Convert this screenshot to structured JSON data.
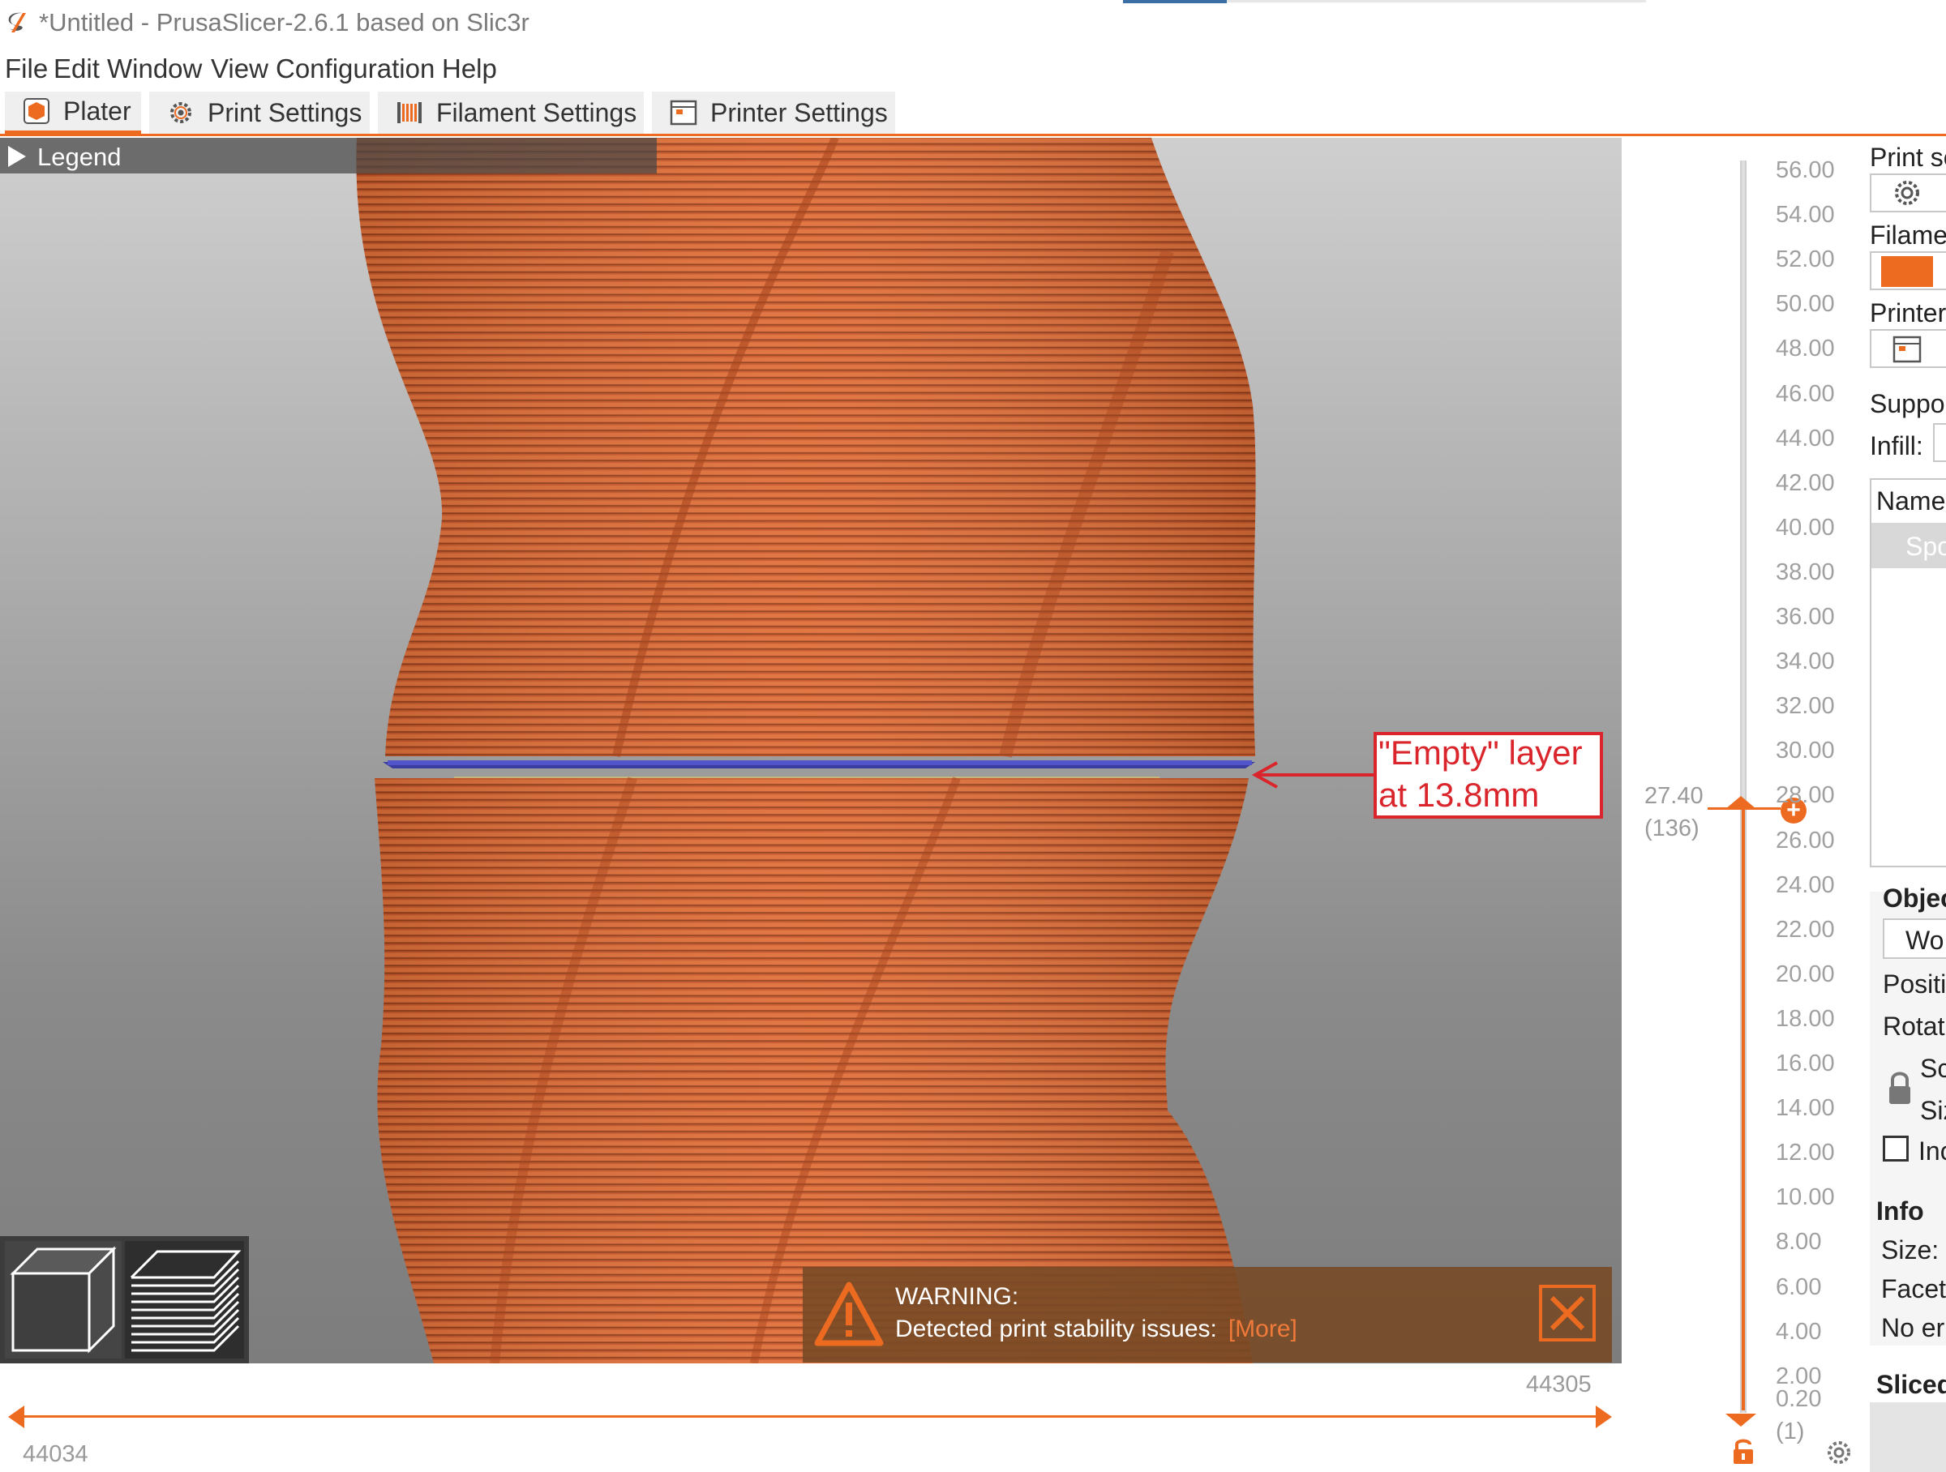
{
  "window": {
    "title": "*Untitled - PrusaSlicer-2.6.1 based on Slic3r"
  },
  "menu": [
    "File",
    "Edit",
    "Window",
    "View",
    "Configuration",
    "Help"
  ],
  "tabs": [
    {
      "label": "Plater",
      "icon": "plater-icon",
      "active": true
    },
    {
      "label": "Print Settings",
      "icon": "gear-icon",
      "active": false
    },
    {
      "label": "Filament Settings",
      "icon": "filament-spool-icon",
      "active": false
    },
    {
      "label": "Printer Settings",
      "icon": "printer-icon",
      "active": false
    }
  ],
  "legend": {
    "label": "Legend"
  },
  "annotation": {
    "line1": "\"Empty\" layer",
    "line2": "at 13.8mm"
  },
  "warning": {
    "title": "WARNING:",
    "text": "Detected print stability issues:",
    "more": "[More]"
  },
  "horizontal_slider": {
    "left_value": "44034",
    "right_value": "44305"
  },
  "vertical_slider": {
    "current_height": "27.40",
    "current_layer": "(136)",
    "bottom_layer": "(1)",
    "ticks": [
      "56.00",
      "54.00",
      "52.00",
      "50.00",
      "48.00",
      "46.00",
      "44.00",
      "42.00",
      "40.00",
      "38.00",
      "36.00",
      "34.00",
      "32.00",
      "30.00",
      "28.00",
      "26.00",
      "24.00",
      "22.00",
      "20.00",
      "18.00",
      "16.00",
      "14.00",
      "12.00",
      "10.00",
      "8.00",
      "6.00",
      "4.00",
      "2.00",
      "0.20"
    ]
  },
  "right_panel": {
    "print_settings_label": "Print se",
    "filament_label": "Filame",
    "printer_label": "Printer",
    "supports_label": "Suppo",
    "infill_label": "Infill:",
    "object_list_header": "Name",
    "object_name": "Spo",
    "object_manipulation_title": "Objec",
    "coordinate_system": "Wo",
    "position_label": "Positi",
    "rotation_label": "Rotat",
    "scale_label": "Sc",
    "size_label": "Siz",
    "inches_label": "Inc",
    "info_title": "Info",
    "info_size": "Size:",
    "info_facets": "Facets",
    "info_errors": "No er",
    "sliced_info_title": "Sliced",
    "filament_color": "#ed6b21"
  },
  "colors": {
    "accent": "#ed6b21",
    "layer": "#d9602a",
    "highlight_layer": "#3b3ea0",
    "annotation": "#d9252b"
  }
}
